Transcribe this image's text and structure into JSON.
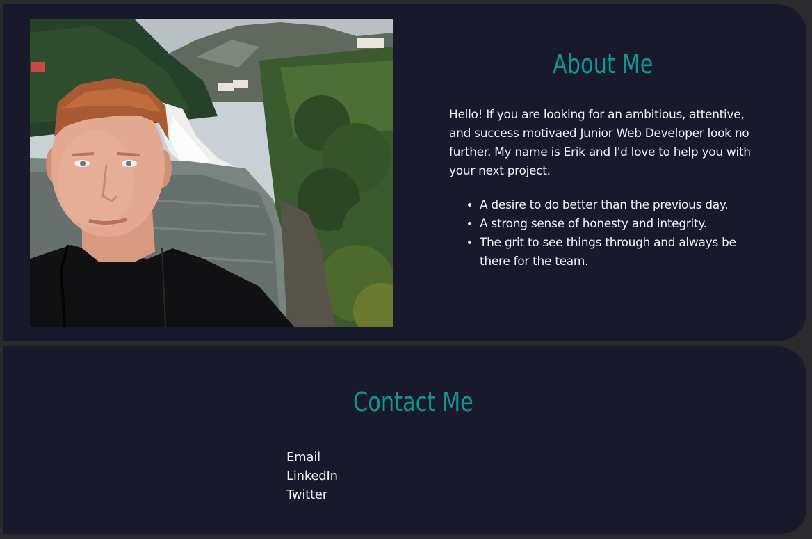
{
  "about": {
    "title": "About Me",
    "intro": "Hello! If you are looking for an ambitious, attentive, and success motivaed Junior Web Developer look no further. My name is Erik and I'd love to help you with your next project.",
    "traits": [
      "A desire to do better than the previous day.",
      "A strong sense of honesty and integrity.",
      "The grit to see things through and always be there for the team."
    ]
  },
  "contact": {
    "title": "Contact Me",
    "links": [
      "Email",
      "LinkedIn",
      "Twitter"
    ]
  },
  "colors": {
    "page_background": "#2b2b2e",
    "panel_background": "#181a2c",
    "heading": "#10988f",
    "text": "#f1f1f4"
  }
}
